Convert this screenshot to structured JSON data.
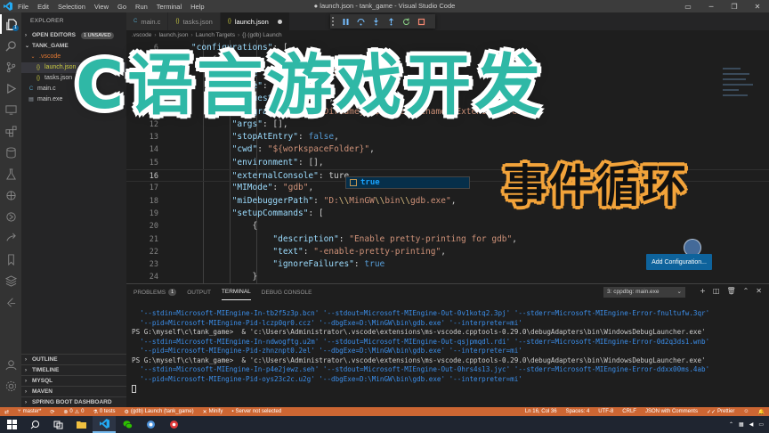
{
  "window": {
    "title": "● launch.json - tank_game - Visual Studio Code",
    "menu": [
      "File",
      "Edit",
      "Selection",
      "View",
      "Go",
      "Run",
      "Terminal",
      "Help"
    ]
  },
  "sidebar": {
    "title": "EXPLORER",
    "open_editors": {
      "label": "OPEN EDITORS",
      "badge": "1 UNSAVED"
    },
    "project": "TANK_GAME",
    "tree": [
      {
        "label": ".vscode",
        "icon": "folder-icon",
        "level": 1
      },
      {
        "label": "launch.json",
        "icon": "json-icon",
        "level": 2
      },
      {
        "label": "tasks.json",
        "icon": "json-icon",
        "level": 2
      },
      {
        "label": "main.c",
        "icon": "c-file-icon",
        "level": 1
      },
      {
        "label": "main.exe",
        "icon": "exe-icon",
        "level": 1
      }
    ],
    "bottom_sections": [
      "OUTLINE",
      "TIMELINE",
      "MYSQL",
      "MAVEN",
      "SPRING BOOT DASHBOARD"
    ]
  },
  "tabs": [
    {
      "label": "main.c",
      "icon": "c-file-icon"
    },
    {
      "label": "tasks.json",
      "icon": "json-icon"
    },
    {
      "label": "launch.json",
      "icon": "json-icon",
      "active": true,
      "modified": true
    }
  ],
  "breadcrumb": [
    ".vscode",
    "launch.json",
    "Launch Targets",
    "{} (gdb) Launch"
  ],
  "code": {
    "lines": [
      {
        "n": "6",
        "text": "    \"configurations\": ["
      },
      {
        "n": "7",
        "text": "        {"
      },
      {
        "n": "8",
        "text": "            \"name\": \"(gdb) Launch\","
      },
      {
        "n": "9",
        "text": "            \"type\": \"cppdbg\","
      },
      {
        "n": "10",
        "text": "            \"request\": \"launch\","
      },
      {
        "n": "11",
        "text": "            \"program\": \"${fileDirname}\\\\${fileBasenameNoExtension}.exe\","
      },
      {
        "n": "12",
        "text": "            \"args\": [],"
      },
      {
        "n": "13",
        "text": "            \"stopAtEntry\": false,"
      },
      {
        "n": "14",
        "text": "            \"cwd\": \"${workspaceFolder}\","
      },
      {
        "n": "15",
        "text": "            \"environment\": [],"
      },
      {
        "n": "16",
        "text": "            \"externalConsole\": ture"
      },
      {
        "n": "17",
        "text": "            \"MIMode\": \"gdb\","
      },
      {
        "n": "18",
        "text": "            \"miDebuggerPath\": \"D:\\\\MinGW\\\\bin\\\\gdb.exe\","
      },
      {
        "n": "19",
        "text": "            \"setupCommands\": ["
      },
      {
        "n": "20",
        "text": "                {"
      },
      {
        "n": "21",
        "text": "                    \"description\": \"Enable pretty-printing for gdb\","
      },
      {
        "n": "22",
        "text": "                    \"text\": \"-enable-pretty-printing\","
      },
      {
        "n": "23",
        "text": "                    \"ignoreFailures\": true"
      },
      {
        "n": "24",
        "text": "                }"
      }
    ],
    "suggestion": "true",
    "add_configuration": "Add Configuration..."
  },
  "panel": {
    "tabs": [
      {
        "label": "PROBLEMS",
        "badge": "1"
      },
      {
        "label": "OUTPUT"
      },
      {
        "label": "TERMINAL",
        "active": true
      },
      {
        "label": "DEBUG CONSOLE"
      }
    ],
    "terminal_select": "3: cppdbg: main.exe",
    "terminal_lines": [
      "  '--stdin=Microsoft-MIEngine-In-tb2f5z3p.bcn' '--stdout=Microsoft-MIEngine-Out-0v1kotq2.3pj' '--stderr=Microsoft-MIEngine-Error-fnultufw.3qr'",
      "  '--pid=Microsoft-MIEngine-Pid-lczp0qr0.ccz' '--dbgExe=D:\\MinGW\\bin\\gdb.exe' '--interpreter=mi'",
      "PS G:\\myself\\c\\tank_game>  & 'c:\\Users\\Administrator\\.vscode\\extensions\\ms-vscode.cpptools-0.29.0\\debugAdapters\\bin\\WindowsDebugLauncher.exe'",
      "  '--stdin=Microsoft-MIEngine-In-ndwogftg.u2m' '--stdout=Microsoft-MIEngine-Out-qsjpmqdl.rdi' '--stderr=Microsoft-MIEngine-Error-0d2q3ds1.wnb'",
      "  '--pid=Microsoft-MIEngine-Pid-zhnznpt0.2el' '--dbgExe=D:\\MinGW\\bin\\gdb.exe' '--interpreter=mi'",
      "PS G:\\myself\\c\\tank_game>  & 'c:\\Users\\Administrator\\.vscode\\extensions\\ms-vscode.cpptools-0.29.0\\debugAdapters\\bin\\WindowsDebugLauncher.exe'",
      "  '--stdin=Microsoft-MIEngine-In-p4e2jewz.seh' '--stdout=Microsoft-MIEngine-Out-0hrs4s13.jyc' '--stderr=Microsoft-MIEngine-Error-ddxx00ms.4ab'",
      "  '--pid=Microsoft-MIEngine-Pid-oys23c2c.u2g' '--dbgExe=D:\\MinGW\\bin\\gdb.exe' '--interpreter=mi'"
    ]
  },
  "statusbar": {
    "branch": "master*",
    "sync": "⟳",
    "errors": "0",
    "warnings": "0",
    "tests": "0 tests",
    "debug_config": "(gdb) Launch (tank_game)",
    "minify": "Minify",
    "server": "Server not selected",
    "position": "Ln 16, Col 36",
    "spaces": "Spaces: 4",
    "encoding": "UTF-8",
    "eol": "CRLF",
    "language": "JSON with Comments",
    "prettier": "Prettier",
    "accent": "#cc6633"
  },
  "overlay": {
    "title": "C语言游戏开发",
    "subtitle": "事件循环"
  }
}
